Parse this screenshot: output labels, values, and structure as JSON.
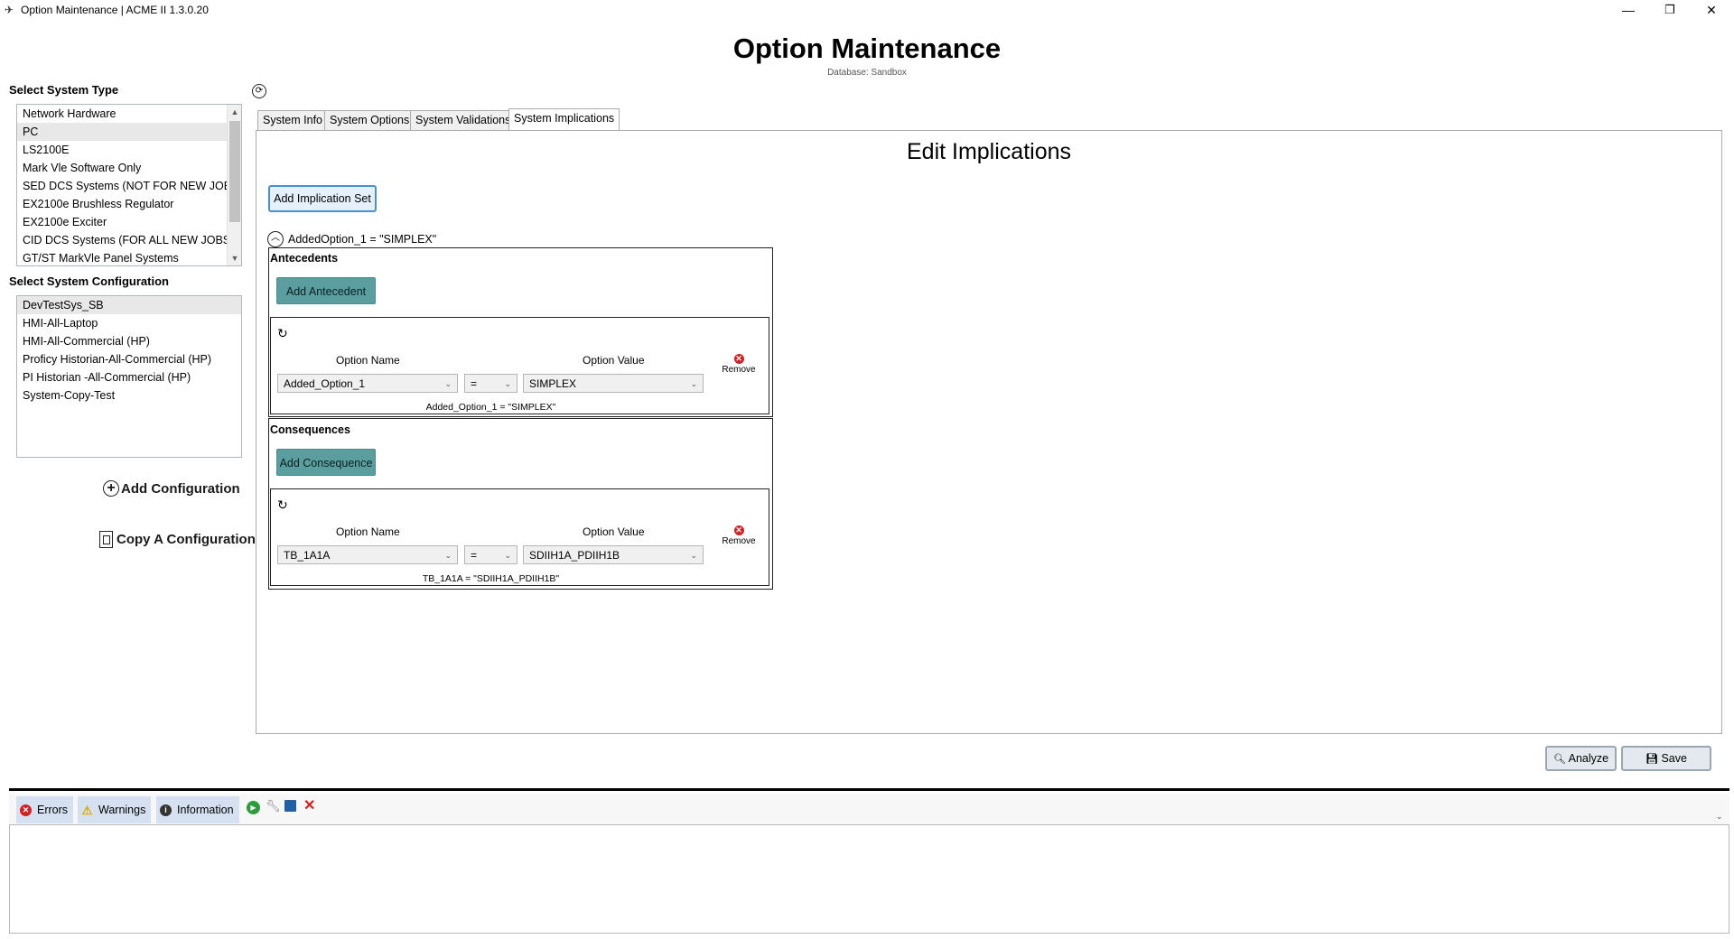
{
  "window": {
    "title": "Option Maintenance | ACME II 1.3.0.20",
    "minimize_glyph": "—",
    "restore_glyph": "❐",
    "close_glyph": "✕"
  },
  "header": {
    "title": "Option Maintenance",
    "database_label": "Database: Sandbox"
  },
  "left": {
    "system_type_label": "Select System Type",
    "system_types": [
      "Network Hardware",
      "PC",
      "LS2100E",
      "Mark Vle Software Only",
      "SED DCS Systems (NOT FOR NEW JOBS)",
      "EX2100e Brushless Regulator",
      "EX2100e Exciter",
      "CID DCS Systems (FOR ALL NEW JOBS)",
      "GT/ST MarkVle Panel Systems"
    ],
    "selected_system_type": "PC",
    "system_config_label": "Select System Configuration",
    "system_configs": [
      "DevTestSys_SB",
      "HMI-All-Laptop",
      "HMI-All-Commercial (HP)",
      "Proficy Historian-All-Commercial (HP)",
      "PI Historian -All-Commercial (HP)",
      "System-Copy-Test"
    ],
    "selected_config": "DevTestSys_SB",
    "add_config_label": "Add Configuration",
    "copy_config_label": "Copy A Configuration"
  },
  "tabs": [
    "System Info",
    "System Options",
    "System Validations",
    "System Implications"
  ],
  "active_tab": "System Implications",
  "editor": {
    "title": "Edit Implications",
    "add_set_label": "Add Implication Set",
    "set_header": "AddedOption_1 = \"SIMPLEX\"",
    "antecedents_label": "Antecedents",
    "add_antecedent_label": "Add Antecedent",
    "consequences_label": "Consequences",
    "add_consequence_label": "Add Consequence",
    "option_name_header": "Option Name",
    "option_value_header": "Option Value",
    "remove_label": "Remove",
    "antecedent": {
      "option_name": "Added_Option_1",
      "operator": "=",
      "option_value": "SIMPLEX",
      "summary": "Added_Option_1 = \"SIMPLEX\""
    },
    "consequence": {
      "option_name": "TB_1A1A",
      "operator": "=",
      "option_value": "SDIIH1A_PDIIH1B",
      "summary": "TB_1A1A = \"SDIIH1A_PDIIH1B\""
    }
  },
  "actions": {
    "analyze_label": "Analyze",
    "save_label": "Save"
  },
  "log": {
    "errors_label": "Errors",
    "warnings_label": "Warnings",
    "information_label": "Information"
  },
  "colors": {
    "accent_teal": "#5b9ea0",
    "focus_blue": "#4a8fd0",
    "error_red": "#d62020",
    "warning_yellow": "#f2c200",
    "log_tab_bg": "#d5e1f0"
  }
}
